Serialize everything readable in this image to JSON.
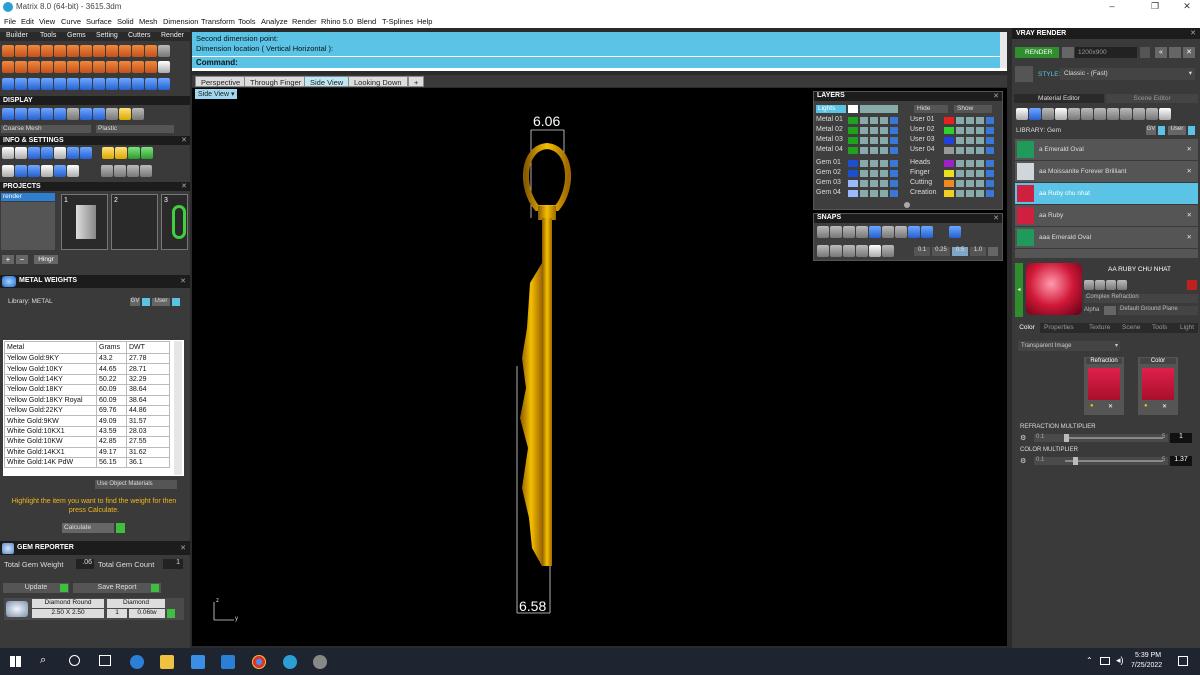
{
  "window": {
    "title": "Matrix 8.0 (64-bit) - 3615.3dm",
    "minimize": "–",
    "maximize": "❐",
    "close": "✕"
  },
  "menu": [
    "File",
    "Edit",
    "View",
    "Curve",
    "Surface",
    "Solid",
    "Mesh",
    "Dimension",
    "Transform",
    "Tools",
    "Analyze",
    "Render",
    "Rhino 5.0",
    "Blend",
    "T-Splines",
    "Help"
  ],
  "toolbar_tabs": [
    "Builder",
    "Tools",
    "Gems",
    "Setting",
    "Cutters",
    "Render"
  ],
  "command": {
    "line1": "Second dimension point:",
    "line2": "Dimension location ( Vertical  Horizontal ):",
    "prompt": "Command:"
  },
  "viewport_tabs": [
    "Perspective",
    "Through Finger",
    "Side View",
    "Looking Down",
    "+"
  ],
  "active_viewport": "Side View",
  "viewport": {
    "label": "Side View",
    "dim_top": "6.06",
    "dim_bottom": "6.58",
    "axis_z": "z",
    "axis_y": "y"
  },
  "display": {
    "title": "DISPLAY",
    "mesh_mode": "Coarse Mesh",
    "material_mode": "Plastic"
  },
  "info": {
    "title": "INFO & SETTINGS"
  },
  "projects": {
    "title": "PROJECTS",
    "item": "render",
    "tiles": [
      "1",
      "2",
      "3"
    ],
    "hingr": "Hingr"
  },
  "metal_weights": {
    "title": "METAL WEIGHTS",
    "library_label": "Library: METAL",
    "gv": "GV",
    "user": "User",
    "headers": [
      "Metal",
      "Grams",
      "DWT"
    ],
    "rows": [
      [
        "Yellow Gold:9KY",
        "43.2",
        "27.78"
      ],
      [
        "Yellow Gold:10KY",
        "44.65",
        "28.71"
      ],
      [
        "Yellow Gold:14KY",
        "50.22",
        "32.29"
      ],
      [
        "Yellow Gold:18KY",
        "60.09",
        "38.64"
      ],
      [
        "Yellow Gold:18KY Royal",
        "60.09",
        "38.64"
      ],
      [
        "Yellow Gold:22KY",
        "69.76",
        "44.86"
      ],
      [
        "White Gold:9KW",
        "49.09",
        "31.57"
      ],
      [
        "White Gold:10KX1",
        "43.59",
        "28.03"
      ],
      [
        "White Gold:10KW",
        "42.85",
        "27.55"
      ],
      [
        "White Gold:14KX1",
        "49.17",
        "31.62"
      ],
      [
        "White Gold:14K PdW",
        "56.15",
        "36.1"
      ]
    ],
    "use_object": "Use Object Materials",
    "hint": "Highlight the item you want to find the weight for then press Calculate.",
    "calculate": "Calculate"
  },
  "gem_reporter": {
    "title": "GEM REPORTER",
    "total_weight_label": "Total Gem Weight",
    "total_weight": ".06",
    "total_count_label": "Total Gem Count",
    "total_count": "1",
    "update": "Update",
    "save_report": "Save Report",
    "gem_name": "Diamond Round",
    "gem_type": "Diamond",
    "gem_size": "2.50 X 2.50",
    "gem_qty": "1",
    "gem_ctw": "0.06tw"
  },
  "layers": {
    "title": "LAYERS",
    "lights": "Lights",
    "hide": "Hide",
    "show": "Show",
    "left": [
      {
        "name": "Metal 01",
        "color": "#1fa31f"
      },
      {
        "name": "Metal 02",
        "color": "#1fa31f"
      },
      {
        "name": "Metal 03",
        "color": "#1fa31f"
      },
      {
        "name": "Metal 04",
        "color": "#1fa31f"
      },
      {
        "name": "Gem 01",
        "color": "#1a4fd0"
      },
      {
        "name": "Gem 02",
        "color": "#1a4fd0"
      },
      {
        "name": "Gem 03",
        "color": "#9ab8ff"
      },
      {
        "name": "Gem 04",
        "color": "#9ab8ff"
      }
    ],
    "right": [
      {
        "name": "User 01",
        "color": "#e82020"
      },
      {
        "name": "User 02",
        "color": "#2ed12e"
      },
      {
        "name": "User 03",
        "color": "#2040e0"
      },
      {
        "name": "User 04",
        "color": "#999999"
      },
      {
        "name": "Heads",
        "color": "#a020c8"
      },
      {
        "name": "Finger",
        "color": "#e8e020"
      },
      {
        "name": "Cutting",
        "color": "#f08a20"
      },
      {
        "name": "Creation",
        "color": "#f0d020"
      }
    ]
  },
  "snaps": {
    "title": "SNAPS",
    "values": [
      "0.1",
      "0.25",
      "0.5",
      "1.0"
    ]
  },
  "vray": {
    "title": "VRAY RENDER",
    "render_btn": "RENDER",
    "resolution": "1200x900",
    "style_label": "STYLE:",
    "style": "Classic - (Fast)",
    "tab_material": "Material Editor",
    "tab_scene": "Scene Editor",
    "library": "LIBRARY: Gem",
    "gv": "GV",
    "user": "User",
    "gems": [
      {
        "name": "a Emerald Oval",
        "color": "#1f9a5a"
      },
      {
        "name": "aa Moissanite Forever Brilliant",
        "color": "#cfd6dc"
      },
      {
        "name": "aa Ruby chu nhat",
        "color": "#d02040"
      },
      {
        "name": "aa Ruby",
        "color": "#d02040"
      },
      {
        "name": "aaa Emerald Oval",
        "color": "#1f9a5a"
      }
    ],
    "selected_gem": "aa Ruby chu nhat",
    "preview_name": "AA RUBY CHU NHAT",
    "shader": "Complex Refraction",
    "alpha": "Alpha",
    "ground": "Default Ground Plane",
    "prop_tabs": [
      "Color",
      "Properties",
      "Texture",
      "Scene",
      "Tools",
      "Light"
    ],
    "dropdown": "Transparent Image",
    "refraction_label": "Refraction",
    "color_label": "Color",
    "refr_mult_label": "REFRACTION MULTIPLIER",
    "refr_min": "0.1",
    "refr_max": "5",
    "refr_val": "1",
    "color_mult_label": "COLOR MULTIPLIER",
    "color_min": "0.1",
    "color_max": "5",
    "color_val": "1.37"
  },
  "taskbar": {
    "time": "5:39 PM",
    "date": "7/25/2022"
  },
  "colors": {
    "accent": "#5bc4e6",
    "gold": "#e0a800",
    "panel": "#3a3a3a",
    "header": "#1c1c1c"
  }
}
